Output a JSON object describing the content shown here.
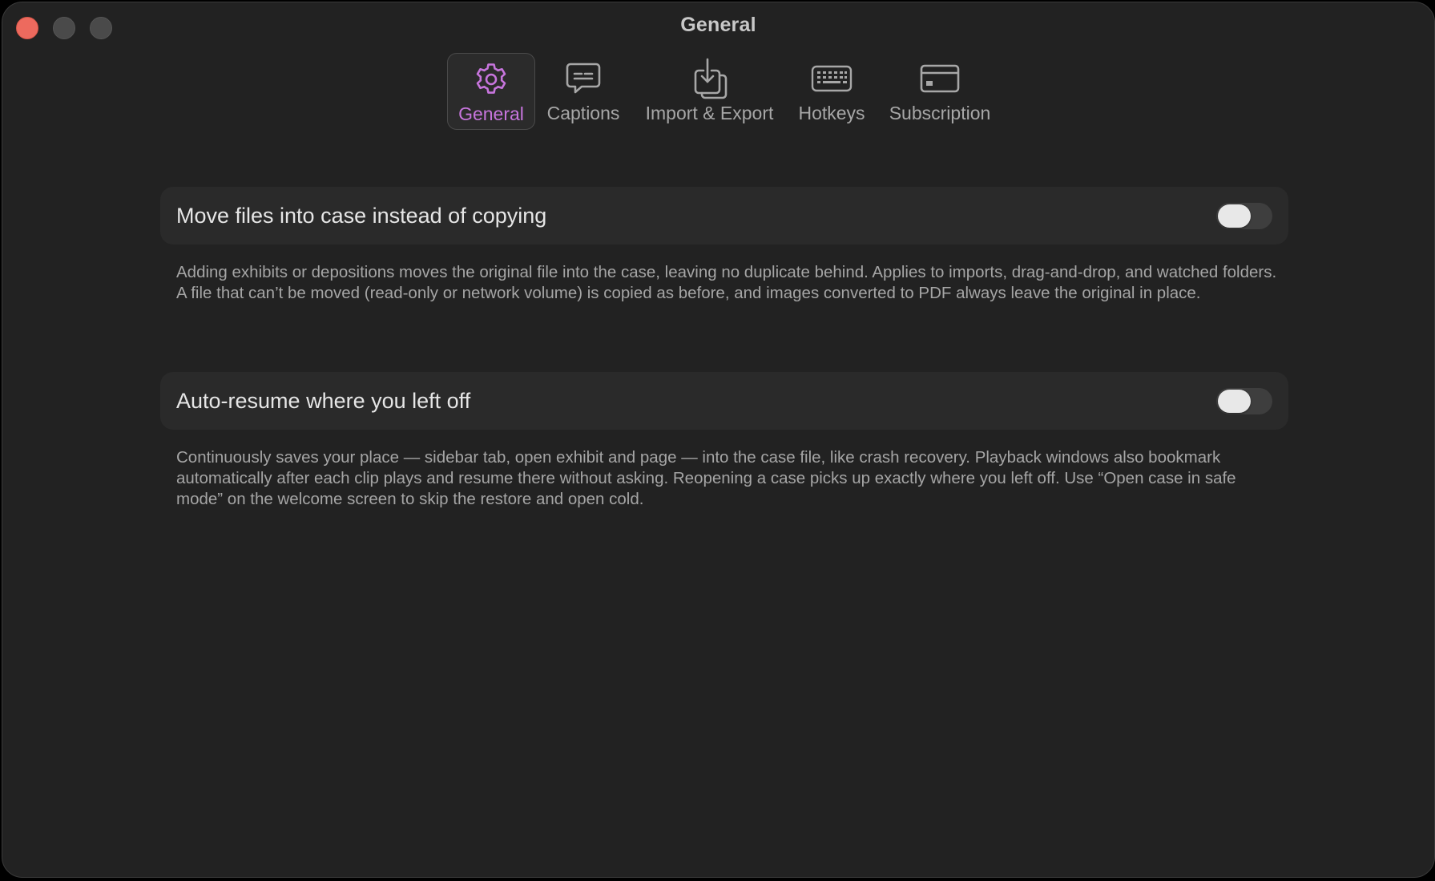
{
  "window": {
    "title": "General"
  },
  "tabs": [
    {
      "label": "General",
      "icon": "gear-icon",
      "active": true
    },
    {
      "label": "Captions",
      "icon": "speech-bubble-icon",
      "active": false
    },
    {
      "label": "Import & Export",
      "icon": "download-tray-icon",
      "active": false
    },
    {
      "label": "Hotkeys",
      "icon": "keyboard-icon",
      "active": false
    },
    {
      "label": "Subscription",
      "icon": "credit-card-icon",
      "active": false
    }
  ],
  "settings": [
    {
      "label": "Move files into case instead of copying",
      "enabled": false,
      "description": "Adding exhibits or depositions moves the original file into the case, leaving no duplicate behind. Applies to imports, drag-and-drop, and watched folders. A file that can’t be moved (read-only or network volume) is copied as before, and images converted to PDF always leave the original in place."
    },
    {
      "label": "Auto-resume where you left off",
      "enabled": false,
      "description": "Continuously saves your place — sidebar tab, open exhibit and page — into the case file, like crash recovery. Playback windows also bookmark automatically after each clip plays and resume there without asking. Reopening a case picks up exactly where you left off. Use “Open case in safe mode” on the welcome screen to skip the restore and open cold."
    }
  ],
  "colors": {
    "accent": "#c775dd",
    "window_bg": "#222222",
    "row_bg": "#2a2a2a",
    "close_button": "#ed6a5e"
  }
}
